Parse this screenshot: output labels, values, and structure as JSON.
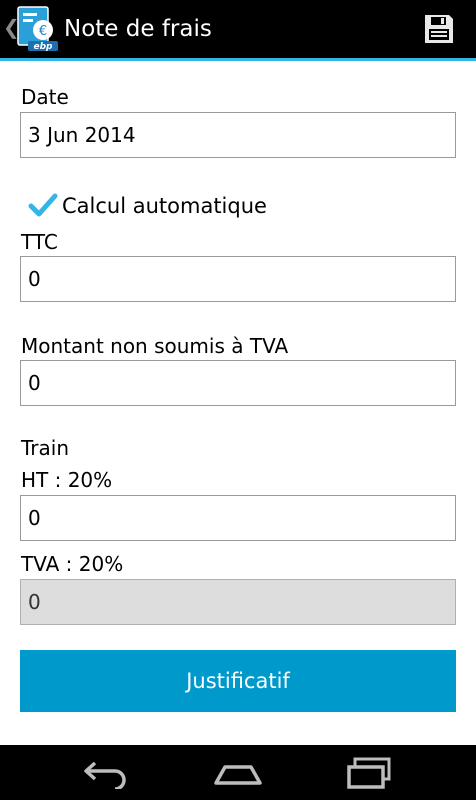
{
  "app": {
    "title": "Note de frais",
    "brand": "ebp"
  },
  "icons": {
    "up": "back-caret-icon",
    "app": "expense-app-icon",
    "save": "save-floppy-icon"
  },
  "form": {
    "date": {
      "label": "Date",
      "value": "3 Jun 2014"
    },
    "auto_calc": {
      "label": "Calcul automatique",
      "checked": true
    },
    "ttc": {
      "label": "TTC",
      "value": "0"
    },
    "non_vat": {
      "label": "Montant non soumis à TVA",
      "value": "0"
    },
    "category": "Train",
    "ht": {
      "label": "HT : 20%",
      "value": "0"
    },
    "tva": {
      "label": "TVA : 20%",
      "value": "0"
    },
    "button": "Justificatif"
  },
  "nav": {
    "back": "nav-back-icon",
    "home": "nav-home-icon",
    "recents": "nav-recents-icon"
  },
  "colors": {
    "accent": "#33b5e5",
    "button": "#0099cc",
    "disabled_field": "#dddddd"
  }
}
